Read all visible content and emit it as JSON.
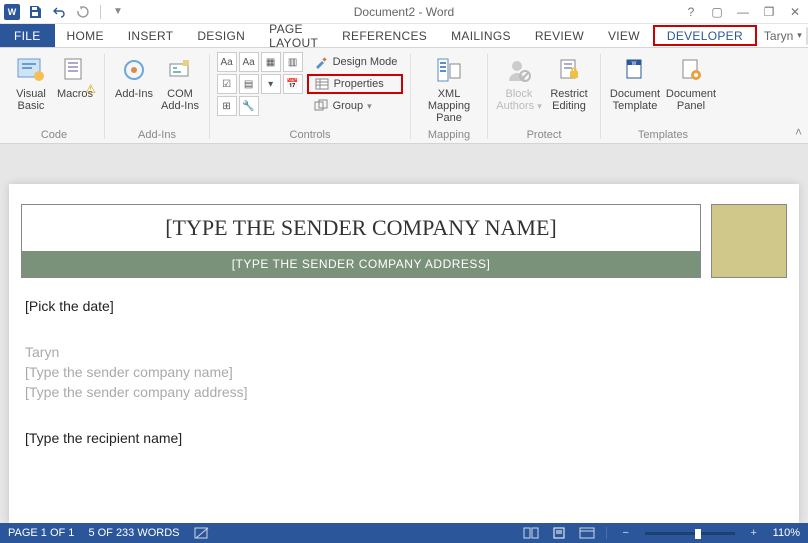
{
  "title": "Document2 - Word",
  "user": "Taryn",
  "tabs": {
    "file": "FILE",
    "home": "HOME",
    "insert": "INSERT",
    "design": "DESIGN",
    "pagelayout": "PAGE LAYOUT",
    "references": "REFERENCES",
    "mailings": "MAILINGS",
    "review": "REVIEW",
    "view": "VIEW",
    "developer": "DEVELOPER"
  },
  "ribbon": {
    "code": {
      "vb_l1": "Visual",
      "vb_l2": "Basic",
      "macros": "Macros",
      "label": "Code"
    },
    "addins": {
      "addins": "Add-Ins",
      "com_l1": "COM",
      "com_l2": "Add-Ins",
      "label": "Add-Ins"
    },
    "controls": {
      "design": "Design Mode",
      "properties": "Properties",
      "group": "Group",
      "label": "Controls"
    },
    "mapping": {
      "xml_l1": "XML Mapping",
      "xml_l2": "Pane",
      "label": "Mapping"
    },
    "protect": {
      "block_l1": "Block",
      "block_l2": "Authors",
      "restrict_l1": "Restrict",
      "restrict_l2": "Editing",
      "label": "Protect"
    },
    "templates": {
      "doctpl_l1": "Document",
      "doctpl_l2": "Template",
      "docpnl_l1": "Document",
      "docpnl_l2": "Panel",
      "label": "Templates"
    }
  },
  "document": {
    "header_name": "[TYPE THE SENDER COMPANY NAME]",
    "header_addr": "[TYPE THE SENDER COMPANY ADDRESS]",
    "pick_date": "[Pick the date]",
    "sender_name": "Taryn",
    "sender_company": "[Type the sender company name]",
    "sender_address": "[Type the sender company address]",
    "recipient": "[Type the recipient name]"
  },
  "status": {
    "page": "PAGE 1 OF 1",
    "words": "5 OF 233 WORDS",
    "zoom": "110%"
  }
}
